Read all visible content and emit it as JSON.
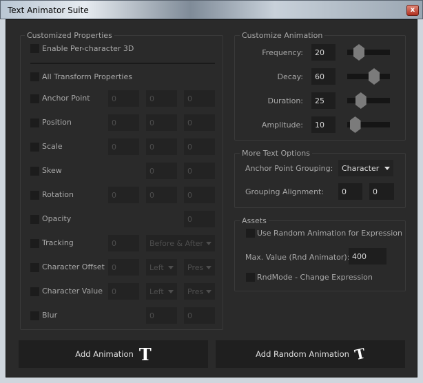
{
  "window": {
    "title": "Text Animator Suite",
    "close": "x"
  },
  "customized": {
    "title": "Customized Properties",
    "enable3d": "Enable Per-character 3D",
    "allTransform": "All Transform Properties",
    "rows": [
      {
        "label": "Anchor Point",
        "fields": [
          "0",
          "0",
          "0"
        ]
      },
      {
        "label": "Position",
        "fields": [
          "0",
          "0",
          "0"
        ]
      },
      {
        "label": "Scale",
        "fields": [
          "0",
          "0",
          "0"
        ]
      },
      {
        "label": "Skew",
        "fields": [
          null,
          "0",
          "0"
        ]
      },
      {
        "label": "Rotation",
        "fields": [
          "0",
          "0",
          "0"
        ]
      },
      {
        "label": "Opacity",
        "fields": [
          null,
          null,
          "0"
        ]
      },
      {
        "label": "Tracking",
        "field": "0",
        "dropdown": "Before & After"
      },
      {
        "label": "Character Offset",
        "field": "0",
        "dd1": "Left",
        "dd2": "Pres"
      },
      {
        "label": "Character Value",
        "field": "0",
        "dd1": "Left",
        "dd2": "Pres"
      },
      {
        "label": "Blur",
        "fields": [
          null,
          "0",
          "0"
        ]
      }
    ]
  },
  "animation": {
    "title": "Customize Animation",
    "slider_max": 100,
    "rows": [
      {
        "label": "Frequency:",
        "value": "20"
      },
      {
        "label": "Decay:",
        "value": "60"
      },
      {
        "label": "Duration:",
        "value": "25"
      },
      {
        "label": "Amplitude:",
        "value": "10"
      }
    ]
  },
  "moreText": {
    "title": "More Text Options",
    "grouping_label": "Anchor Point Grouping:",
    "grouping_value": "Character",
    "alignment_label": "Grouping Alignment:",
    "alignment": [
      "0",
      "0"
    ]
  },
  "assets": {
    "title": "Assets",
    "useRandom": "Use Random Animation for Expression",
    "maxLabel": "Max. Value (Rnd Animator):",
    "maxValue": "400",
    "rndMode": "RndMode - Change Expression"
  },
  "buttons": {
    "add": "Add Animation",
    "addRandom": "Add Random Animation",
    "icon": "T"
  }
}
